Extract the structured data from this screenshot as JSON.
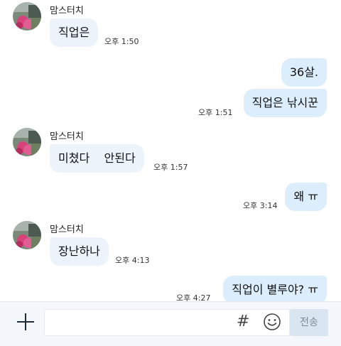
{
  "colors": {
    "incoming_bubble": "#ecf3fb",
    "outgoing_bubble": "#dceefc",
    "input_bar": "#f4f7fb",
    "send_button": "#d9e6f2"
  },
  "messages": [
    {
      "sender": "맘스터치",
      "text": "직업은",
      "time": "오후 1:50"
    },
    {
      "text": "36살.",
      "direction": "out"
    },
    {
      "text": "직업은 낚시꾼",
      "time": "오후 1:51",
      "direction": "out"
    },
    {
      "sender": "맘스터치",
      "text": "미쳤다    안된다",
      "time": "오후 1:57"
    },
    {
      "text": "왜 ㅠ",
      "time": "오후 3:14",
      "direction": "out"
    },
    {
      "sender": "맘스터치",
      "text": "장난하나",
      "time": "오후 4:13"
    },
    {
      "text": "직업이 별루야? ㅠ",
      "time": "오후 4:27",
      "direction": "out"
    }
  ],
  "input_bar": {
    "plus_icon": "plus-icon",
    "hash_icon": "#",
    "emoji_icon": "smiley-icon",
    "send_label": "전송",
    "message_value": ""
  }
}
